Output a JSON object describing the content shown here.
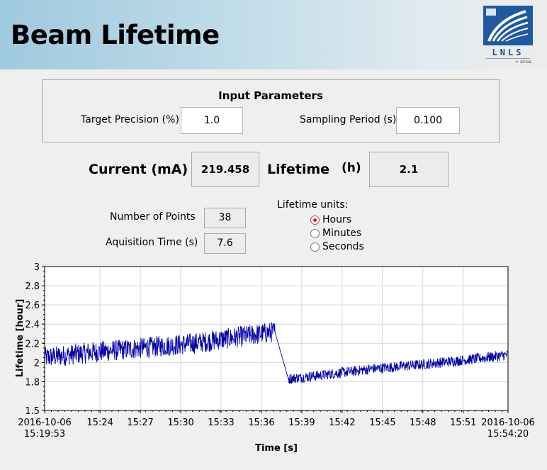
{
  "header": {
    "title": "Beam Lifetime",
    "logo_text": "LNLS",
    "logo_subtext": "+ sirius"
  },
  "params": {
    "title": "Input Parameters",
    "target_precision_label": "Target Precision (%)",
    "target_precision_value": "1.0",
    "sampling_period_label": "Sampling Period (s)",
    "sampling_period_value": "0.100"
  },
  "readout": {
    "current_label": "Current (mA)",
    "current_value": "219.458",
    "lifetime_label": "Lifetime",
    "lifetime_unit": "(h)",
    "lifetime_value": "2.1"
  },
  "stats": {
    "points_label": "Number of Points",
    "points_value": "38",
    "time_label": "Aquisition Time (s)",
    "time_value": "7.6"
  },
  "units": {
    "label": "Lifetime units:",
    "options": [
      "Hours",
      "Minutes",
      "Seconds"
    ],
    "selected": "Hours"
  },
  "colors": {
    "series": "#0000aa",
    "radio_selected": "#d81e1e"
  },
  "chart_data": {
    "type": "line",
    "title": "",
    "xlabel": "Time [s]",
    "ylabel": "Lifetime [hour]",
    "ylim": [
      1.5,
      3
    ],
    "yticks": [
      "3",
      "2.8",
      "2.6",
      "2.4",
      "2.2",
      "2",
      "1.8",
      "1.5"
    ],
    "xticks": [
      [
        "2016-10-06",
        "15:19:53"
      ],
      [
        "15:24"
      ],
      [
        "15:27"
      ],
      [
        "15:30"
      ],
      [
        "15:33"
      ],
      [
        "15:36"
      ],
      [
        "15:39"
      ],
      [
        "15:42"
      ],
      [
        "15:45"
      ],
      [
        "15:48"
      ],
      [
        "15:51"
      ],
      [
        "2016-10-06",
        "15:54:20"
      ]
    ],
    "grid": true,
    "series": [
      {
        "x": [
          "15:19:53",
          "15:23:00",
          "15:27:00",
          "15:31:00",
          "15:35:00",
          "15:37:00",
          "15:38:00",
          "15:40:00",
          "15:44:00",
          "15:48:00",
          "15:52:00",
          "15:54:20"
        ],
        "values": [
          2.05,
          2.1,
          2.15,
          2.2,
          2.28,
          2.32,
          1.83,
          1.86,
          1.93,
          1.98,
          2.04,
          2.08
        ]
      }
    ]
  }
}
